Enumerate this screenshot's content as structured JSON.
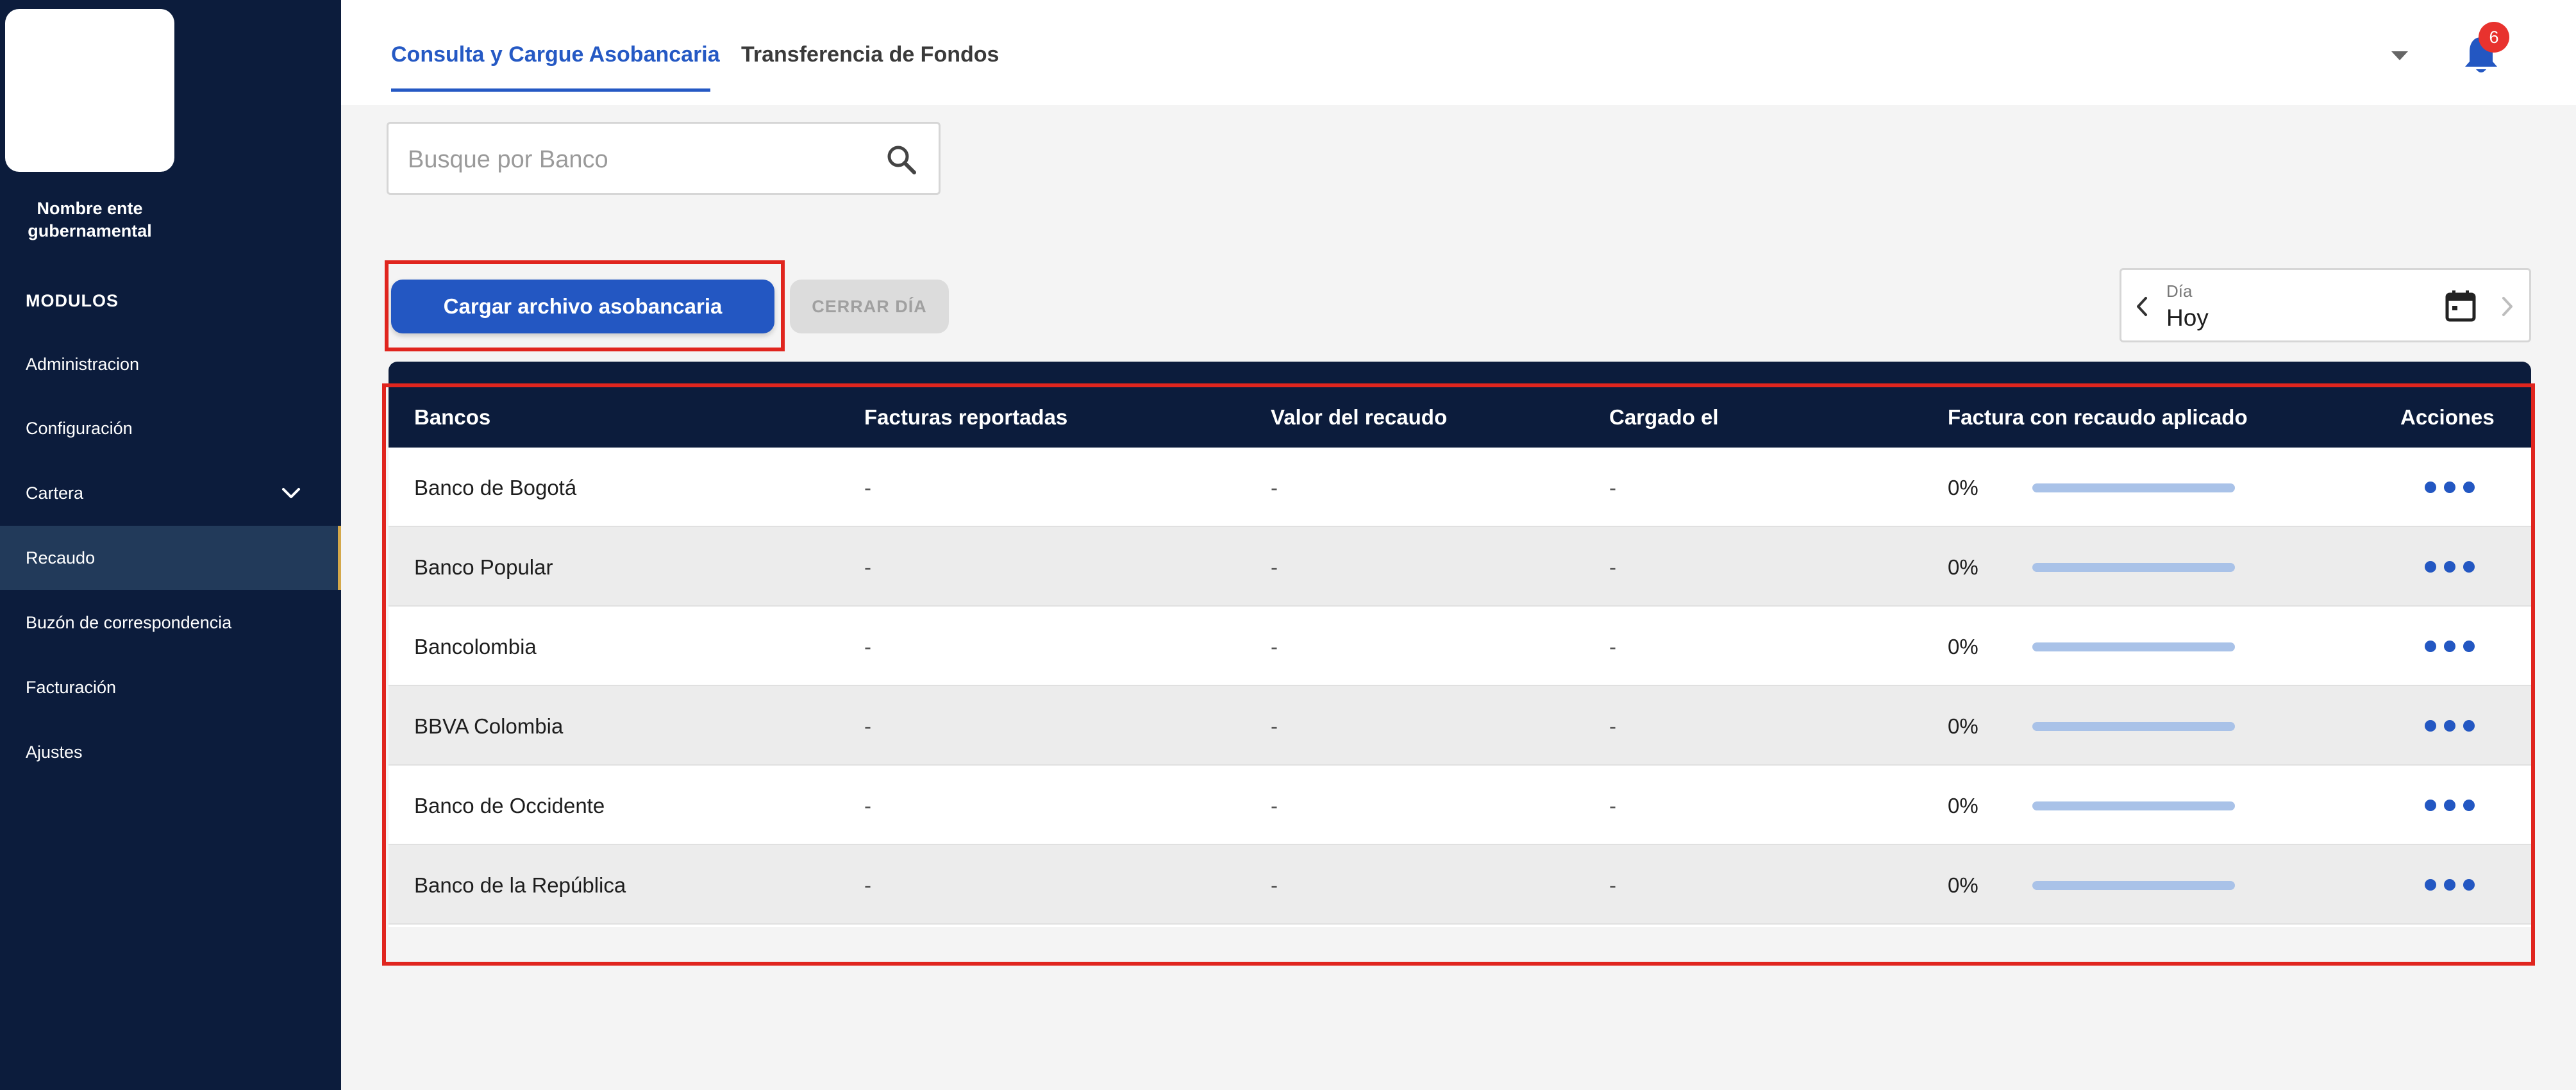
{
  "sidebar": {
    "entity_name": "Nombre ente gubernamental",
    "modules_title": "MODULOS",
    "items": [
      {
        "label": "Administracion"
      },
      {
        "label": "Configuración"
      },
      {
        "label": "Cartera"
      },
      {
        "label": "Recaudo"
      },
      {
        "label": "Buzón de correspondencia"
      },
      {
        "label": "Facturación"
      },
      {
        "label": "Ajustes"
      }
    ],
    "active_item": "Recaudo"
  },
  "header": {
    "tabs": [
      {
        "label": "Consulta y Cargue Asobancaria"
      },
      {
        "label": "Transferencia de Fondos"
      }
    ],
    "active_tab": "Consulta y Cargue Asobancaria",
    "notification_count": "6"
  },
  "search": {
    "placeholder": "Busque por Banco",
    "value": ""
  },
  "actions": {
    "upload_label": "Cargar archivo asobancaria",
    "close_day_label": "CERRAR DÍA"
  },
  "date_picker": {
    "label": "Día",
    "value": "Hoy"
  },
  "table": {
    "columns": [
      "Bancos",
      "Facturas reportadas",
      "Valor del recaudo",
      "Cargado el",
      "Factura con recaudo aplicado",
      "Acciones"
    ],
    "rows": [
      {
        "bank": "Banco de Bogotá",
        "invoices": "-",
        "amount": "-",
        "loaded": "-",
        "applied": "0%",
        "progress": 0
      },
      {
        "bank": "Banco Popular",
        "invoices": "-",
        "amount": "-",
        "loaded": "-",
        "applied": "0%",
        "progress": 0
      },
      {
        "bank": "Bancolombia",
        "invoices": "-",
        "amount": "-",
        "loaded": "-",
        "applied": "0%",
        "progress": 0
      },
      {
        "bank": "BBVA Colombia",
        "invoices": "-",
        "amount": "-",
        "loaded": "-",
        "applied": "0%",
        "progress": 0
      },
      {
        "bank": "Banco de Occidente",
        "invoices": "-",
        "amount": "-",
        "loaded": "-",
        "applied": "0%",
        "progress": 0
      },
      {
        "bank": "Banco de la República",
        "invoices": "-",
        "amount": "-",
        "loaded": "-",
        "applied": "0%",
        "progress": 0
      }
    ]
  },
  "colors": {
    "sidebar_bg": "#0c1c3c",
    "accent_blue": "#2357c2",
    "highlight_red": "#e0251e",
    "badge_red": "#e8322e",
    "progress_track": "#a9c2e8"
  }
}
